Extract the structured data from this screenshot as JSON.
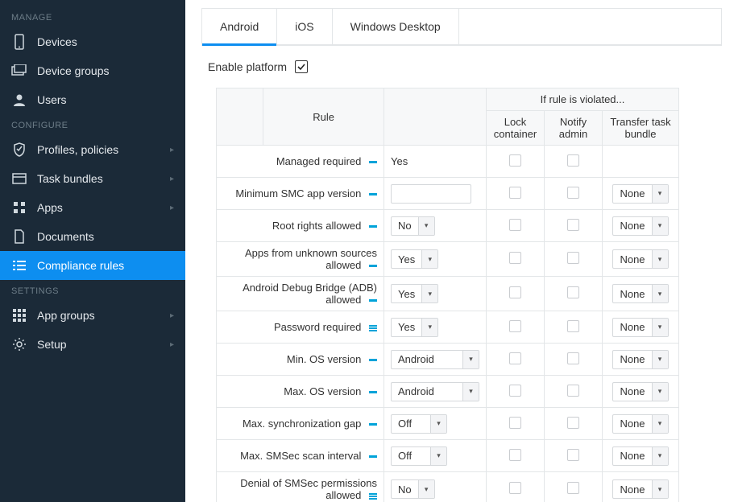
{
  "sidebar": {
    "sections": [
      {
        "label": "MANAGE",
        "items": [
          {
            "id": "devices",
            "label": "Devices",
            "icon": "smartphone"
          },
          {
            "id": "device-groups",
            "label": "Device groups",
            "icon": "folders"
          },
          {
            "id": "users",
            "label": "Users",
            "icon": "user"
          }
        ]
      },
      {
        "label": "CONFIGURE",
        "items": [
          {
            "id": "profiles-policies",
            "label": "Profiles, policies",
            "icon": "shield",
            "expandable": true
          },
          {
            "id": "task-bundles",
            "label": "Task bundles",
            "icon": "package",
            "expandable": true
          },
          {
            "id": "apps",
            "label": "Apps",
            "icon": "grid",
            "expandable": true
          },
          {
            "id": "documents",
            "label": "Documents",
            "icon": "document"
          },
          {
            "id": "compliance-rules",
            "label": "Compliance rules",
            "icon": "list",
            "active": true
          }
        ]
      },
      {
        "label": "SETTINGS",
        "items": [
          {
            "id": "app-groups",
            "label": "App groups",
            "icon": "grid2",
            "expandable": true
          },
          {
            "id": "setup",
            "label": "Setup",
            "icon": "gear",
            "expandable": true
          }
        ]
      }
    ]
  },
  "tabs": [
    {
      "id": "android",
      "label": "Android",
      "active": true
    },
    {
      "id": "ios",
      "label": "iOS"
    },
    {
      "id": "windows",
      "label": "Windows Desktop"
    }
  ],
  "enable_platform": {
    "label": "Enable platform",
    "checked": true
  },
  "table": {
    "header": {
      "rule": "Rule",
      "violated": "If rule is violated...",
      "lock": "Lock container",
      "notify": "Notify admin",
      "transfer": "Transfer task bundle"
    },
    "none_label": "None",
    "rows": [
      {
        "name": "Managed required",
        "marker": "dashed",
        "value_text": "Yes",
        "control": "text",
        "lock": false,
        "notify": false,
        "transfer": null
      },
      {
        "name": "Minimum SMC app version",
        "marker": "solid",
        "value_text": "",
        "control": "input",
        "lock": false,
        "notify": false,
        "transfer": "None"
      },
      {
        "name": "Root rights allowed",
        "marker": "solid",
        "value_text": "No",
        "control": "select",
        "lock": false,
        "notify": false,
        "transfer": "None"
      },
      {
        "name": "Apps from unknown sources allowed",
        "marker": "solid",
        "value_text": "Yes",
        "control": "select",
        "lock": false,
        "notify": false,
        "transfer": "None"
      },
      {
        "name": "Android Debug Bridge (ADB) allowed",
        "marker": "solid",
        "value_text": "Yes",
        "control": "select",
        "lock": false,
        "notify": false,
        "transfer": "None"
      },
      {
        "name": "Password required",
        "marker": "bars",
        "value_text": "Yes",
        "control": "select",
        "lock": false,
        "notify": false,
        "transfer": "None"
      },
      {
        "name": "Min. OS version",
        "marker": "solid",
        "value_text": "Android",
        "control": "select_wide",
        "lock": false,
        "notify": false,
        "transfer": "None"
      },
      {
        "name": "Max. OS version",
        "marker": "solid",
        "value_text": "Android",
        "control": "select_wide",
        "lock": false,
        "notify": false,
        "transfer": "None"
      },
      {
        "name": "Max. synchronization gap",
        "marker": "dashed",
        "value_text": "Off",
        "control": "select_xwide",
        "lock": false,
        "notify": false,
        "transfer": "None"
      },
      {
        "name": "Max. SMSec scan interval",
        "marker": "dashed",
        "value_text": "Off",
        "control": "select_xwide",
        "lock": false,
        "notify": false,
        "transfer": "None"
      },
      {
        "name": "Denial of SMSec permissions allowed",
        "marker": "bars",
        "value_text": "No",
        "control": "select",
        "lock": false,
        "notify": false,
        "transfer": "None"
      }
    ]
  }
}
